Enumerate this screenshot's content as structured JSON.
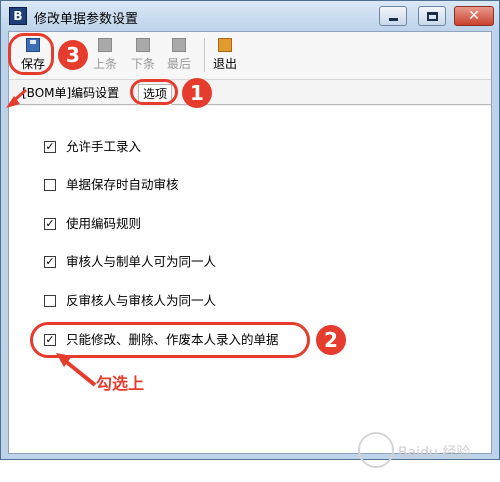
{
  "window": {
    "title": "修改单据参数设置",
    "app_icon": "B"
  },
  "toolbar": {
    "save_label": "保存",
    "prev_label": "上条",
    "next_label": "下条",
    "last_label": "最后",
    "exit_label": "退出"
  },
  "tabs": {
    "tab1": "[BOM单]编码设置",
    "tab2": "选项"
  },
  "options": [
    {
      "label": "允许手工录入",
      "checked": true
    },
    {
      "label": "单据保存时自动审核",
      "checked": false
    },
    {
      "label": "使用编码规则",
      "checked": true
    },
    {
      "label": "审核人与制单人可为同一人",
      "checked": true
    },
    {
      "label": "反审核人与审核人为同一人",
      "checked": false
    },
    {
      "label": "只能修改、删除、作废本人录入的单据",
      "checked": true
    }
  ],
  "annotations": {
    "n1": "1",
    "n2": "2",
    "n3": "3",
    "note": "勾选上"
  },
  "watermark": {
    "text": "Baidu 经验"
  },
  "colors": {
    "annotation": "#e53c2e",
    "titlebar": "#bcd3ea",
    "close": "#c9422e"
  }
}
